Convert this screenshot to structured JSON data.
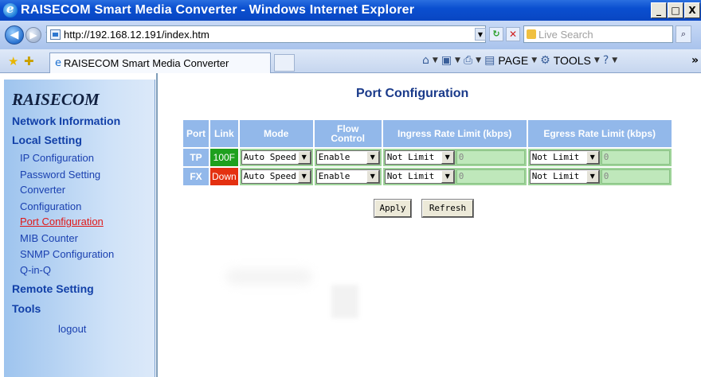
{
  "window": {
    "title": "RAISECOM Smart Media Converter - Windows Internet Explorer",
    "min_glyph": "_",
    "max_glyph": "□",
    "close_glyph": "X"
  },
  "addressbar": {
    "url": "http://192.168.12.191/index.htm",
    "search_placeholder": "Live Search"
  },
  "tabs": [
    {
      "label": "RAISECOM Smart Media Converter"
    }
  ],
  "commandbar": {
    "page_label": "PAGE",
    "tools_label": "TOOLS"
  },
  "sidebar": {
    "brand": "RAISECOM",
    "network_information": "Network Information",
    "local_setting": "Local Setting",
    "items": [
      {
        "label": "IP Configuration"
      },
      {
        "label": "Password Setting"
      },
      {
        "label": "Converter"
      },
      {
        "label": "Configuration"
      },
      {
        "label": "Port Configuration"
      },
      {
        "label": "MIB Counter"
      },
      {
        "label": "SNMP Configuration"
      },
      {
        "label": "Q-in-Q"
      }
    ],
    "remote_setting": "Remote Setting",
    "tools": "Tools",
    "logout": "logout"
  },
  "main": {
    "title": "Port Configuration",
    "table": {
      "headers": {
        "port": "Port",
        "link": "Link",
        "mode": "Mode",
        "flow_line1": "Flow",
        "flow_line2": "Control",
        "ingress": "Ingress Rate Limit (kbps)",
        "egress": "Egress Rate Limit (kbps)"
      },
      "rows": [
        {
          "port": "TP",
          "link": "100F",
          "mode": "Auto Speed",
          "flow": "Enable",
          "ingress": "Not Limit",
          "ingress_value": "0",
          "egress": "Not Limit",
          "egress_value": "0"
        },
        {
          "port": "FX",
          "link": "Down",
          "mode": "Auto Speed",
          "flow": "Enable",
          "ingress": "Not Limit",
          "ingress_value": "0",
          "egress": "Not Limit",
          "egress_value": "0"
        }
      ]
    },
    "apply_label": "Apply",
    "refresh_label": "Refresh"
  },
  "colors": {
    "link_up": "#1ea01e",
    "link_down": "#e43010",
    "header_bg": "#92b8ea",
    "active_menu": "#e01818"
  }
}
